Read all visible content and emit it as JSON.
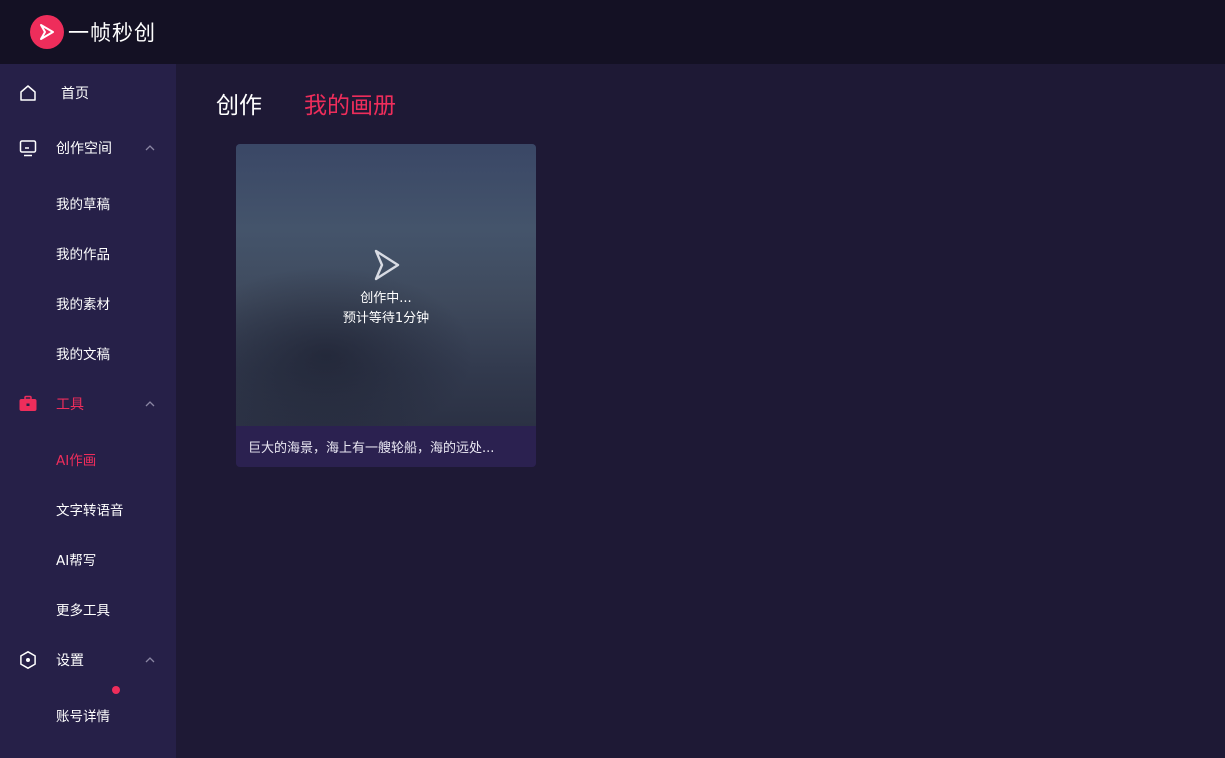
{
  "app": {
    "name": "一帧秒创",
    "logo_icon": "play-triangle-icon"
  },
  "colors": {
    "accent": "#ee2d5b",
    "topbar": "#141124",
    "sidebar": "#262048",
    "main": "#1e1935"
  },
  "sidebar": {
    "home": {
      "label": "首页",
      "icon": "home-icon"
    },
    "workspace": {
      "label": "创作空间",
      "icon": "monitor-icon",
      "expanded": true,
      "items": [
        {
          "label": "我的草稿"
        },
        {
          "label": "我的作品"
        },
        {
          "label": "我的素材"
        },
        {
          "label": "我的文稿"
        }
      ]
    },
    "tools": {
      "label": "工具",
      "icon": "toolbox-icon",
      "expanded": true,
      "active": true,
      "items": [
        {
          "label": "AI作画",
          "active": true
        },
        {
          "label": "文字转语音"
        },
        {
          "label": "AI帮写"
        },
        {
          "label": "更多工具"
        }
      ]
    },
    "settings": {
      "label": "设置",
      "icon": "settings-hex-icon",
      "expanded": true,
      "items": [
        {
          "label": "账号详情"
        }
      ]
    }
  },
  "tabs": [
    {
      "label": "创作",
      "active": false
    },
    {
      "label": "我的画册",
      "active": true
    }
  ],
  "gallery": [
    {
      "status_line1": "创作中...",
      "status_line2": "预计等待1分钟",
      "caption": "巨大的海景，海上有一艘轮船，海的远处..."
    }
  ]
}
